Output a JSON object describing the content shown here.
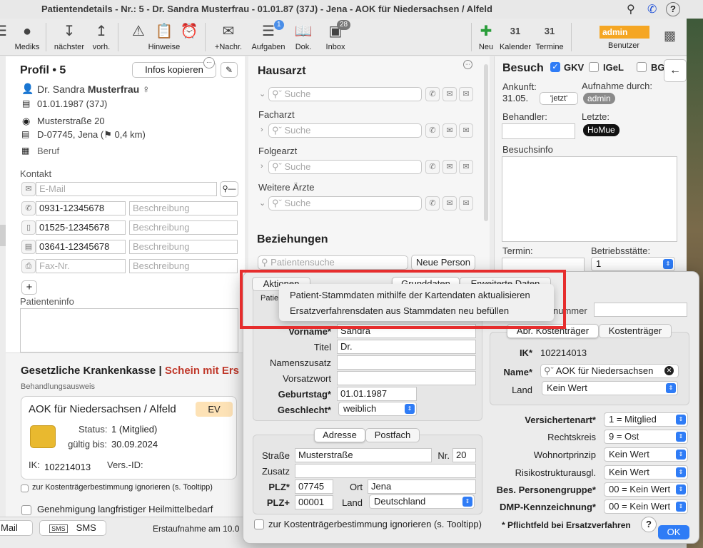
{
  "window_title": "Patientendetails - Nr.: 5 - Dr.  Sandra Musterfrau - 01.01.87 (37J) - Jena - AOK für Niedersachsen / Alfeld",
  "toolbar": {
    "mediks": "Mediks",
    "naechster": "nächster",
    "vorh": "vorh.",
    "hinweise": "Hinweise",
    "nachr": "+Nachr.",
    "aufgaben": "Aufgaben",
    "aufgaben_badge": "1",
    "dok": "Dok.",
    "inbox": "Inbox",
    "inbox_badge": "28",
    "neu": "Neu",
    "kalender": "Kalender",
    "termine": "Termine",
    "cal_day": "31",
    "user_value": "admin",
    "benutzer": "Benutzer"
  },
  "profil": {
    "title": "Profil •",
    "number": "5",
    "copy_button": "Infos kopieren",
    "prefix": "Dr.",
    "first_name": "Sandra",
    "last_name": "Musterfrau",
    "birthdate": "01.01.1987 (37J)",
    "street": "Musterstraße 20",
    "city": "D-07745, Jena (⚑ 0,4 km)",
    "beruf": "Beruf"
  },
  "kontakt": {
    "label": "Kontakt",
    "email_placeholder": "E-Mail",
    "phone1": "0931-12345678",
    "mobile": "01525-12345678",
    "phone2": "03641-12345678",
    "fax_placeholder": "Fax-Nr.",
    "desc_placeholder": "Beschreibung",
    "patienteninfo": "Patienteninfo"
  },
  "kasse": {
    "title": "Gesetzliche Krankenkasse |",
    "schein": "Schein mit Ers",
    "behandlungsausweis": "Behandlungsausweis",
    "card_name": "AOK für Niedersachsen / Alfeld",
    "ev": "EV",
    "status_label": "Status:",
    "status_value": "1 (Mitglied)",
    "gueltig_label": "gültig bis:",
    "gueltig_value": "30.09.2024",
    "ik_label": "IK:",
    "ik_value": "102214013",
    "vers_label": "Vers.-ID:",
    "ignore_check": "zur Kostenträgerbestimmung ignorieren (s. Tooltipp)",
    "genehmigung": "Genehmigung langfristiger Heilmittelbedarf"
  },
  "footer": {
    "mail": "Mail",
    "sms": "SMS",
    "erstaufnahme": "Erstaufnahme am 10.0"
  },
  "hausarzt": {
    "title": "Hausarzt",
    "search_placeholder": "Suche",
    "facharzt": "Facharzt",
    "folgearzt": "Folgearzt",
    "weitere": "Weitere Ärzte",
    "beziehungen": "Beziehungen",
    "patient_search": "Patientensuche",
    "neue_person": "Neue Person"
  },
  "besuch": {
    "title": "Besuch",
    "gkv": "GKV",
    "igel": "IGeL",
    "bg": "BG",
    "ankunft_label": "Ankunft:",
    "ankunft_value": "31.05.",
    "jetzt": "'jetzt'",
    "aufnahme_label": "Aufnahme durch:",
    "aufnahme_value": "admin",
    "behandler_label": "Behandler:",
    "letzte_label": "Letzte:",
    "letzte_value": "HoMue",
    "besuchsinfo": "Besuchsinfo",
    "termin_label": "Termin:",
    "betriebsstaette_label": "Betriebsstätte:",
    "betriebsstaette_value": "1"
  },
  "dialog": {
    "aktionen": "Aktionen",
    "tab_grund": "Grunddaten",
    "tab_erw": "Erweiterte Daten",
    "patie": "Patie",
    "nummer": "nummer",
    "vorname_label": "Vorname*",
    "vorname": "Sandra",
    "titel_label": "Titel",
    "titel": "Dr.",
    "namenszusatz_label": "Namenszusatz",
    "vorsatzwort_label": "Vorsatzwort",
    "geburtstag_label": "Geburtstag*",
    "geburtstag": "01.01.1987",
    "geschlecht_label": "Geschlecht*",
    "geschlecht": "weiblich",
    "adresse_tab": "Adresse",
    "postfach_tab": "Postfach",
    "strasse_label": "Straße",
    "strasse": "Musterstraße",
    "nr_label": "Nr.",
    "nr": "20",
    "zusatz_label": "Zusatz",
    "plz_label": "PLZ*",
    "plz": "07745",
    "ort_label": "Ort",
    "ort": "Jena",
    "plzplus_label": "PLZ+",
    "plzplus": "00001",
    "land_label": "Land",
    "land": "Deutschland",
    "abr_tab": "Abr. Kostenträger",
    "kt_tab": "Kostenträger",
    "ik_label": "IK*",
    "ik": "102214013",
    "name_label": "Name*",
    "name": "AOK für Niedersachsen",
    "kt_land_label": "Land",
    "kt_land": "Kein Wert",
    "versichertenart_label": "Versichertenart*",
    "versichertenart": "1 = Mitglied",
    "rechtskreis_label": "Rechtskreis",
    "rechtskreis": "9 = Ost",
    "wohnort_label": "Wohnortprinzip",
    "wohnort": "Kein Wert",
    "risiko_label": "Risikostrukturausgl.",
    "risiko": "Kein Wert",
    "personengruppe_label": "Bes. Personengruppe*",
    "personengruppe": "00 = Kein Wert",
    "dmp_label": "DMP-Kennzeichnung*",
    "dmp": "00 = Kein Wert",
    "ignore": "zur Kostenträgerbestimmung ignorieren (s. Tooltipp)",
    "pflicht": "* Pflichtfeld bei Ersatzverfahren",
    "help": "?",
    "ok": "OK"
  },
  "context_menu": {
    "item1": "Patient-Stammdaten mithilfe der Kartendaten aktualisieren",
    "item2": "Ersatzverfahrensdaten aus Stammdaten neu befüllen"
  }
}
